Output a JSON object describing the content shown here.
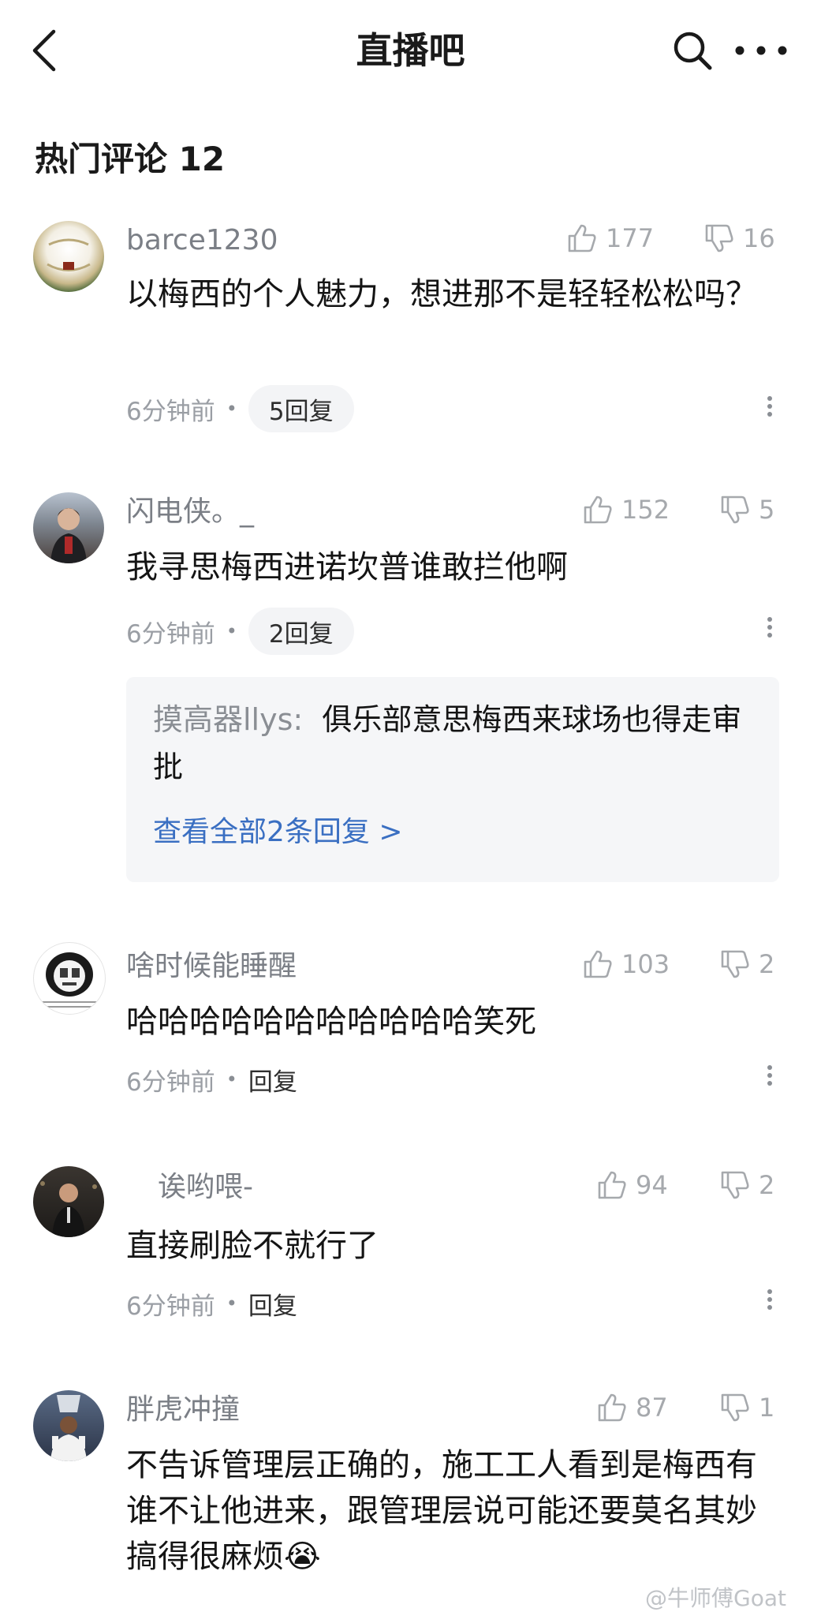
{
  "header": {
    "title": "直播吧"
  },
  "section": {
    "title": "热门评论 12"
  },
  "comments": [
    {
      "user": "barce1230",
      "likes": "177",
      "dislikes": "16",
      "text": "以梅西的个人魅力，想进那不是轻轻松松吗？",
      "time": "6分钟前",
      "reply": "5回复"
    },
    {
      "user": "闪电侠。_",
      "likes": "152",
      "dislikes": "5",
      "text": "我寻思梅西进诺坎普谁敢拦他啊",
      "time": "6分钟前",
      "reply": "2回复",
      "subreply": {
        "name": "摸高器llys:",
        "text": "俱乐部意思梅西来球场也得走审批",
        "view_all": "查看全部2条回复 >"
      }
    },
    {
      "user": "啥时候能睡醒",
      "likes": "103",
      "dislikes": "2",
      "text": "哈哈哈哈哈哈哈哈哈哈哈笑死",
      "time": "6分钟前",
      "reply": "回复"
    },
    {
      "user": "诶哟喂-",
      "likes": "94",
      "dislikes": "2",
      "text": "直接刷脸不就行了",
      "time": "6分钟前",
      "reply": "回复"
    },
    {
      "user": "胖虎冲撞",
      "likes": "87",
      "dislikes": "1",
      "text": "不告诉管理层正确的，施工工人看到是梅西有谁不让他进来，跟管理层说可能还要莫名其妙搞得很麻烦😭",
      "time": "",
      "reply": ""
    }
  ],
  "watermark": "@牛师傅Goat",
  "colors": {
    "link": "#3a6fc2",
    "meta": "#9a9ea4",
    "username": "#7b7f86",
    "subbox": "#f5f6f8"
  },
  "icons": [
    "back-arrow-icon",
    "search-icon",
    "more-icon",
    "thumbs-up-icon",
    "thumbs-down-icon",
    "kebab-menu-icon"
  ]
}
